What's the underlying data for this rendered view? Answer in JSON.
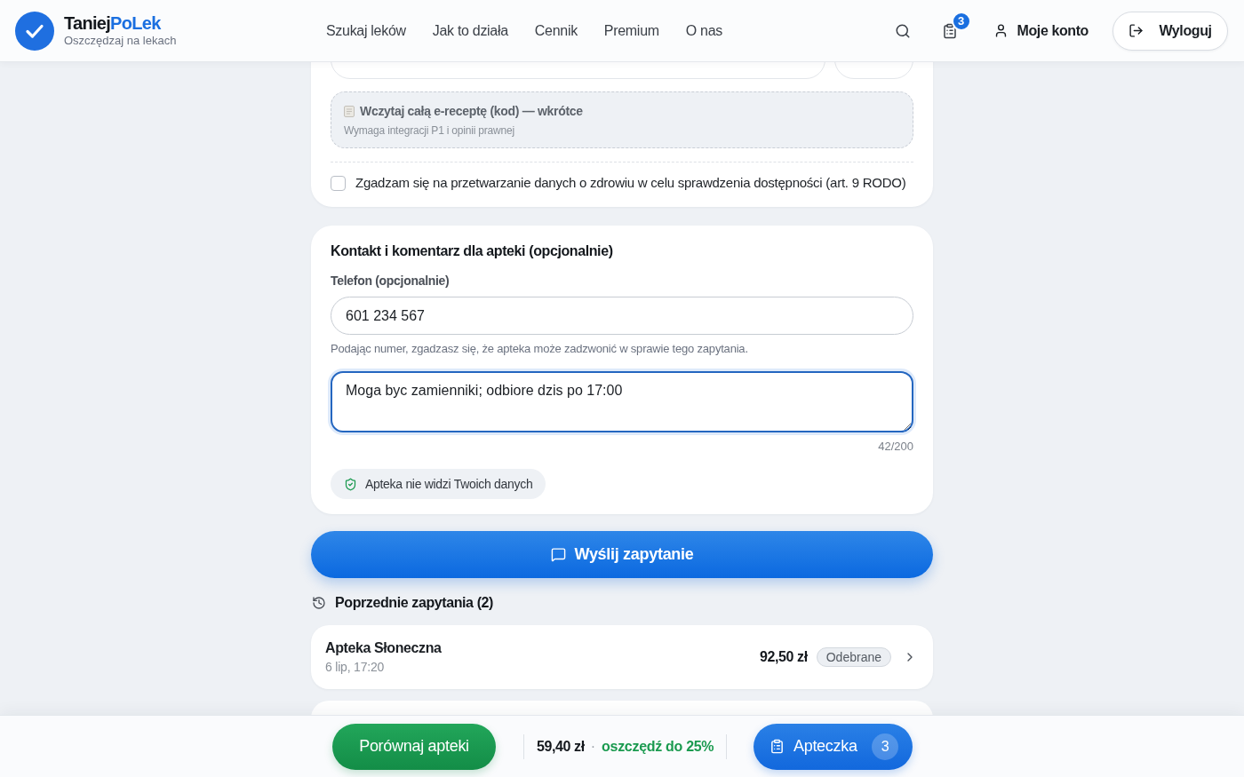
{
  "header": {
    "brand": {
      "name_main": "Taniej",
      "name_accent": "PoLek",
      "tagline": "Oszczędzaj na lekach"
    },
    "nav": [
      "Szukaj leków",
      "Jak to działa",
      "Cennik",
      "Premium",
      "O nas"
    ],
    "cabinet_count": "3",
    "account_label": "Moje konto",
    "logout_label": "Wyloguj"
  },
  "search_card": {
    "eprescription": {
      "title": "Wczytaj całą e-receptę (kod) — wkrótce",
      "note": "Wymaga integracji P1 i opinii prawnej",
      "disabled": true
    },
    "consent": {
      "label": "Zgadzam się na przetwarzanie danych o zdrowiu w celu sprawdzenia dostępności (art. 9 RODO)",
      "checked": false
    }
  },
  "contact_card": {
    "title": "Kontakt i komentarz dla apteki (opcjonalnie)",
    "phone": {
      "label": "Telefon (opcjonalnie)",
      "value": "601 234 567",
      "hint": "Podając numer, zgadzasz się, że apteka może zadzwonić w sprawie tego zapytania."
    },
    "comment": {
      "value": "Moga byc zamienniki; odbiore dzis po 17:00",
      "focused": true,
      "counter": "42/200"
    },
    "privacy_badge": "Apteka nie widzi Twoich danych"
  },
  "send_button": "Wyślij zapytanie",
  "history": {
    "title": "Poprzednie zapytania (2)",
    "items": [
      {
        "pharmacy": "Apteka Słoneczna",
        "date": "6 lip, 17:20",
        "price": "92,50 zł",
        "status": "Odebrane"
      }
    ]
  },
  "bottom_bar": {
    "compare_button": "Porównaj apteki",
    "total": "59,40 zł",
    "separator": "·",
    "savings": "oszczędź do 25%",
    "cabinet_button": "Apteczka",
    "cabinet_count": "3"
  }
}
